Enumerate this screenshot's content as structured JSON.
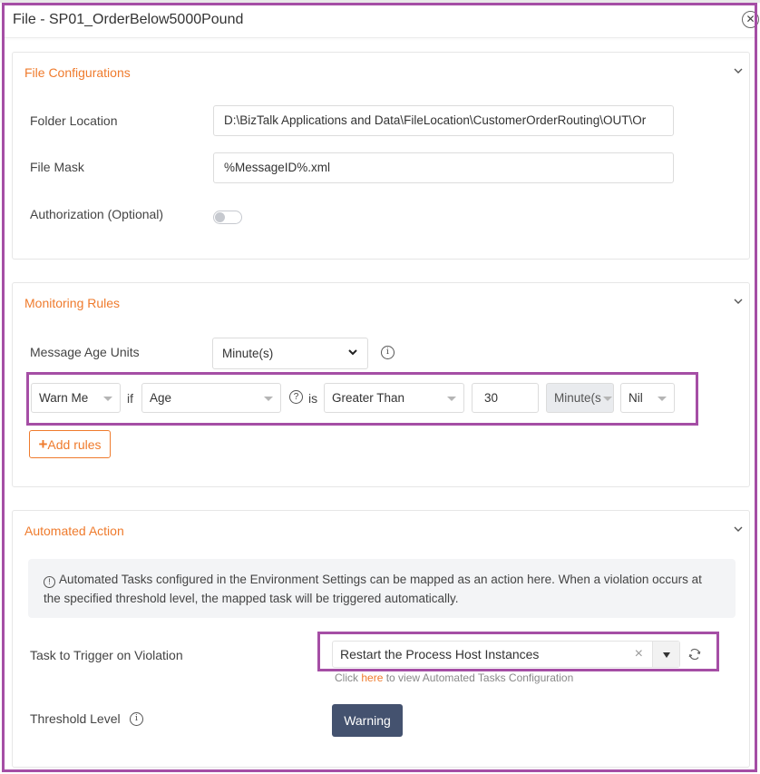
{
  "window": {
    "title": "File - SP01_OrderBelow5000Pound",
    "close_icon": "circle-x-icon"
  },
  "file_configurations": {
    "title": "File Configurations",
    "folder_location_label": "Folder Location",
    "folder_location_value": "D:\\BizTalk Applications and Data\\FileLocation\\CustomerOrderRouting\\OUT\\Or",
    "file_mask_label": "File Mask",
    "file_mask_value": "%MessageID%.xml",
    "authorization_label": "Authorization (Optional)",
    "authorization_enabled": false
  },
  "monitoring_rules": {
    "title": "Monitoring Rules",
    "message_age_units_label": "Message Age Units",
    "message_age_units_value": "Minute(s)",
    "rule": {
      "severity": "Warn Me",
      "if_text": "if",
      "metric": "Age",
      "is_text": "is",
      "operator": "Greater Than",
      "threshold": "30",
      "unit": "Minute(s",
      "extra": "Nil"
    },
    "add_rules_label": "Add rules"
  },
  "automated_action": {
    "title": "Automated Action",
    "note": "Automated Tasks configured in the Environment Settings can be mapped as an action here. When a violation occurs at the specified threshold level, the mapped task will be triggered automatically.",
    "task_label": "Task to Trigger on Violation",
    "task_value": "Restart the Process Host Instances",
    "help_prefix": "Click",
    "help_link": "here",
    "help_suffix": "to view Automated Tasks Configuration",
    "threshold_label": "Threshold Level",
    "threshold_value": "Warning"
  },
  "colors": {
    "accent_orange": "#ef7b2d",
    "highlight_purple": "#a54ea5",
    "warning_button": "#44526f"
  }
}
